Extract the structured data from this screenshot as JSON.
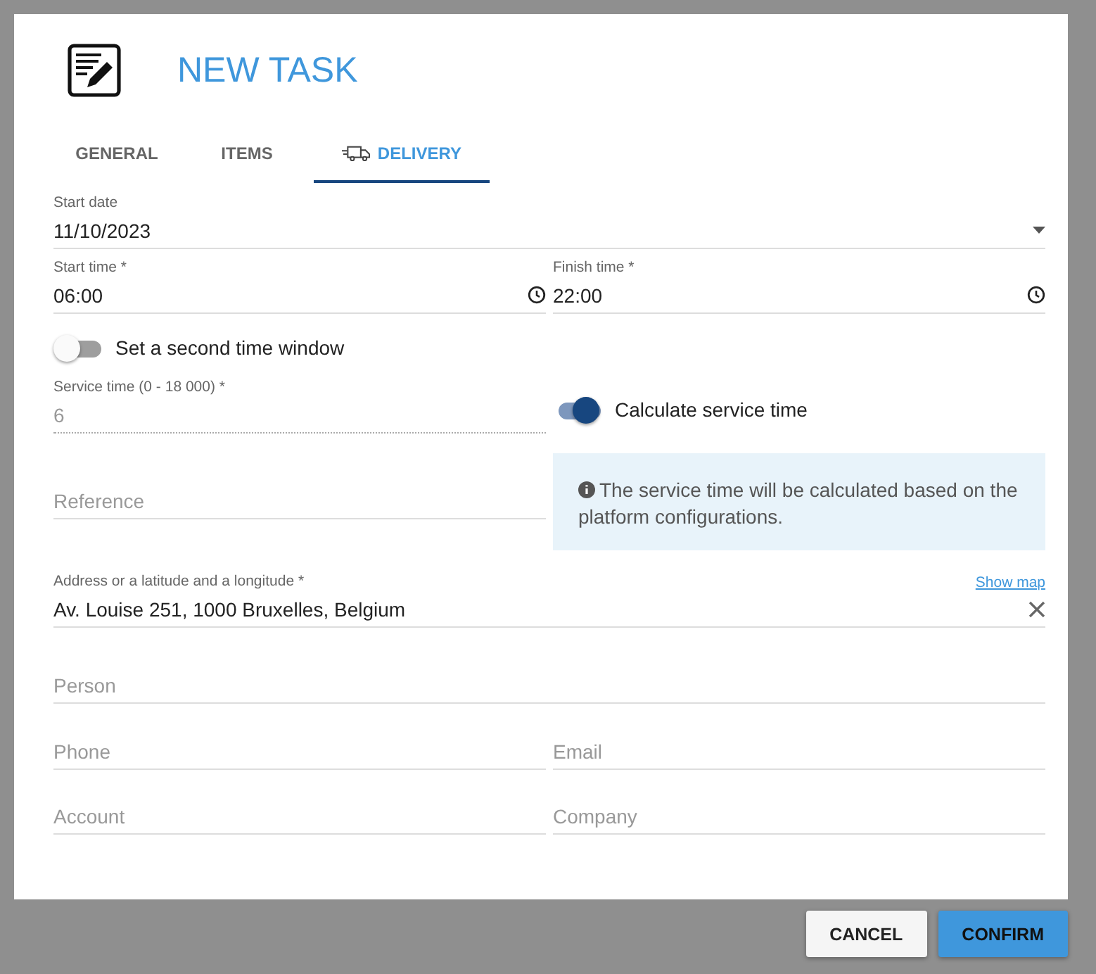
{
  "dialog": {
    "title": "NEW TASK"
  },
  "tabs": [
    {
      "label": "GENERAL",
      "selected": false,
      "kind": "text"
    },
    {
      "label": "ITEMS",
      "selected": false,
      "kind": "text"
    },
    {
      "label": "DELIVERY",
      "selected": true,
      "kind": "truck"
    }
  ],
  "start_date": {
    "label": "Start date",
    "value": "11/10/2023"
  },
  "start_time": {
    "label": "Start time *",
    "value": "06:00"
  },
  "finish_time": {
    "label": "Finish time *",
    "value": "22:00"
  },
  "second_window": {
    "label": "Set a second time window",
    "on": false
  },
  "service_time": {
    "label": "Service time (0 - 18 000) *",
    "value": "6",
    "disabled": true
  },
  "calculate_service": {
    "label": "Calculate service time",
    "on": true
  },
  "reference": {
    "placeholder": "Reference"
  },
  "info": {
    "text": "The service time will be calculated based on the platform configurations."
  },
  "address": {
    "label": "Address or a latitude and a longitude *",
    "value": "Av. Louise 251, 1000 Bruxelles, Belgium",
    "link": "Show map"
  },
  "person": {
    "placeholder": "Person"
  },
  "phone": {
    "placeholder": "Phone"
  },
  "email": {
    "placeholder": "Email"
  },
  "account": {
    "placeholder": "Account"
  },
  "company": {
    "placeholder": "Company"
  },
  "buttons": [
    {
      "label": "CANCEL",
      "kind": "secondary"
    },
    {
      "label": "CONFIRM",
      "kind": "primary"
    }
  ]
}
